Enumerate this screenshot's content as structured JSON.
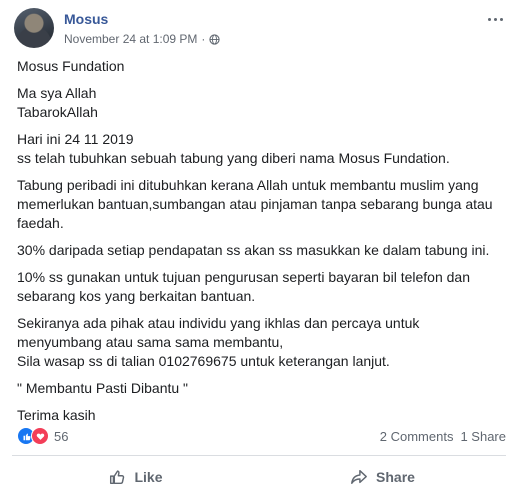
{
  "post": {
    "author": "Mosus",
    "date": "November 24 at 1:09 PM",
    "separator": "·",
    "paragraphs": [
      "Mosus Fundation",
      "Ma sya Allah\nTabarokAllah",
      "Hari ini 24 11 2019\nss telah tubuhkan sebuah tabung yang diberi nama Mosus Fundation.",
      "Tabung peribadi ini ditubuhkan kerana Allah untuk membantu muslim yang memerlukan bantuan,sumbangan atau pinjaman tanpa sebarang bunga atau faedah.",
      "30% daripada setiap pendapatan ss akan ss masukkan ke dalam tabung ini.",
      "10% ss gunakan untuk tujuan pengurusan seperti bayaran bil telefon dan sebarang kos yang berkaitan bantuan.",
      "Sekiranya ada pihak atau individu yang ikhlas dan percaya untuk menyumbang atau sama sama membantu,\nSila wasap ss di talian 0102769675 untuk keterangan lanjut.",
      "\" Membantu Pasti Dibantu \"",
      "Terima kasih"
    ]
  },
  "stats": {
    "reaction_count": "56",
    "comments": "2 Comments",
    "shares": "1 Share"
  },
  "actions": {
    "like": "Like",
    "share": "Share"
  },
  "icons": {
    "privacy": "globe-icon",
    "more": "more-options-icon",
    "like_reaction": "like-reaction-icon",
    "love_reaction": "love-reaction-icon",
    "like_action": "thumbs-up-icon",
    "share_action": "share-arrow-icon"
  },
  "colors": {
    "author": "#385898",
    "like": "#1877f2",
    "love": "#f33e58",
    "muted": "#606770"
  }
}
